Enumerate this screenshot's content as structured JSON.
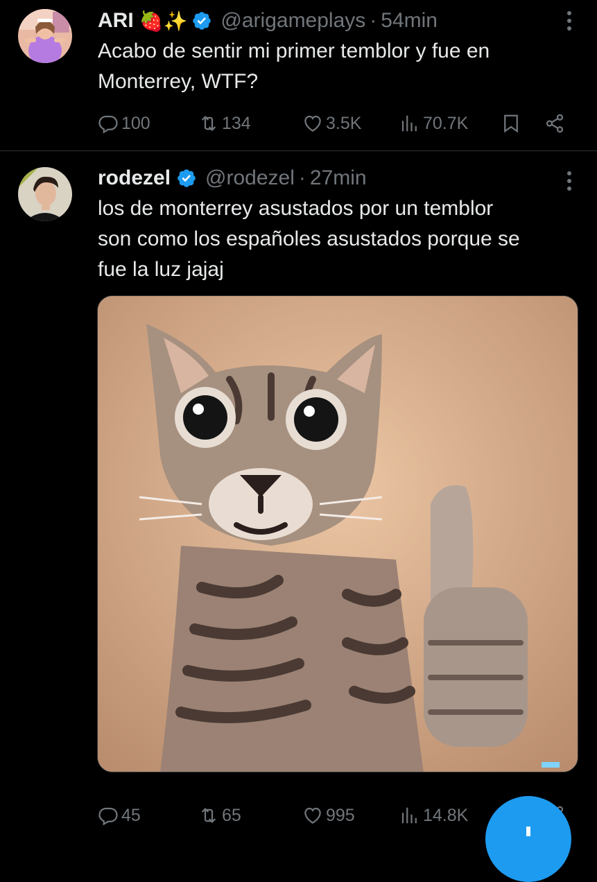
{
  "tweets": [
    {
      "name": "ARI",
      "emojis": "🍓✨",
      "handle": "@arigameplays",
      "time": "54min",
      "text_lines": [
        "Acabo de sentir mi primer temblor y fue en",
        "Monterrey, WTF?"
      ],
      "stats": {
        "replies": "100",
        "retweets": "134",
        "likes": "3.5K",
        "views": "70.7K"
      }
    },
    {
      "name": "rodezel",
      "handle": "@rodezel",
      "time": "27min",
      "text_lines": [
        "los de monterrey asustados por un temblor",
        "son como los españoles asustados porque se",
        "fue la luz jajaj"
      ],
      "stats": {
        "replies": "45",
        "retweets": "65",
        "likes": "995",
        "views": "14.8K"
      }
    }
  ],
  "separator": "·",
  "icons": {
    "verified": "verified-badge-icon",
    "more": "more-vertical-icon",
    "reply": "reply-icon",
    "retweet": "retweet-icon",
    "like": "heart-icon",
    "views": "views-icon",
    "bookmark": "bookmark-icon",
    "share": "share-icon",
    "compose": "compose-plus-icon"
  },
  "colors": {
    "background": "#000000",
    "text": "#e7e9ea",
    "muted": "#71767b",
    "divider": "#2f3336",
    "accent": "#1d9bf0"
  }
}
